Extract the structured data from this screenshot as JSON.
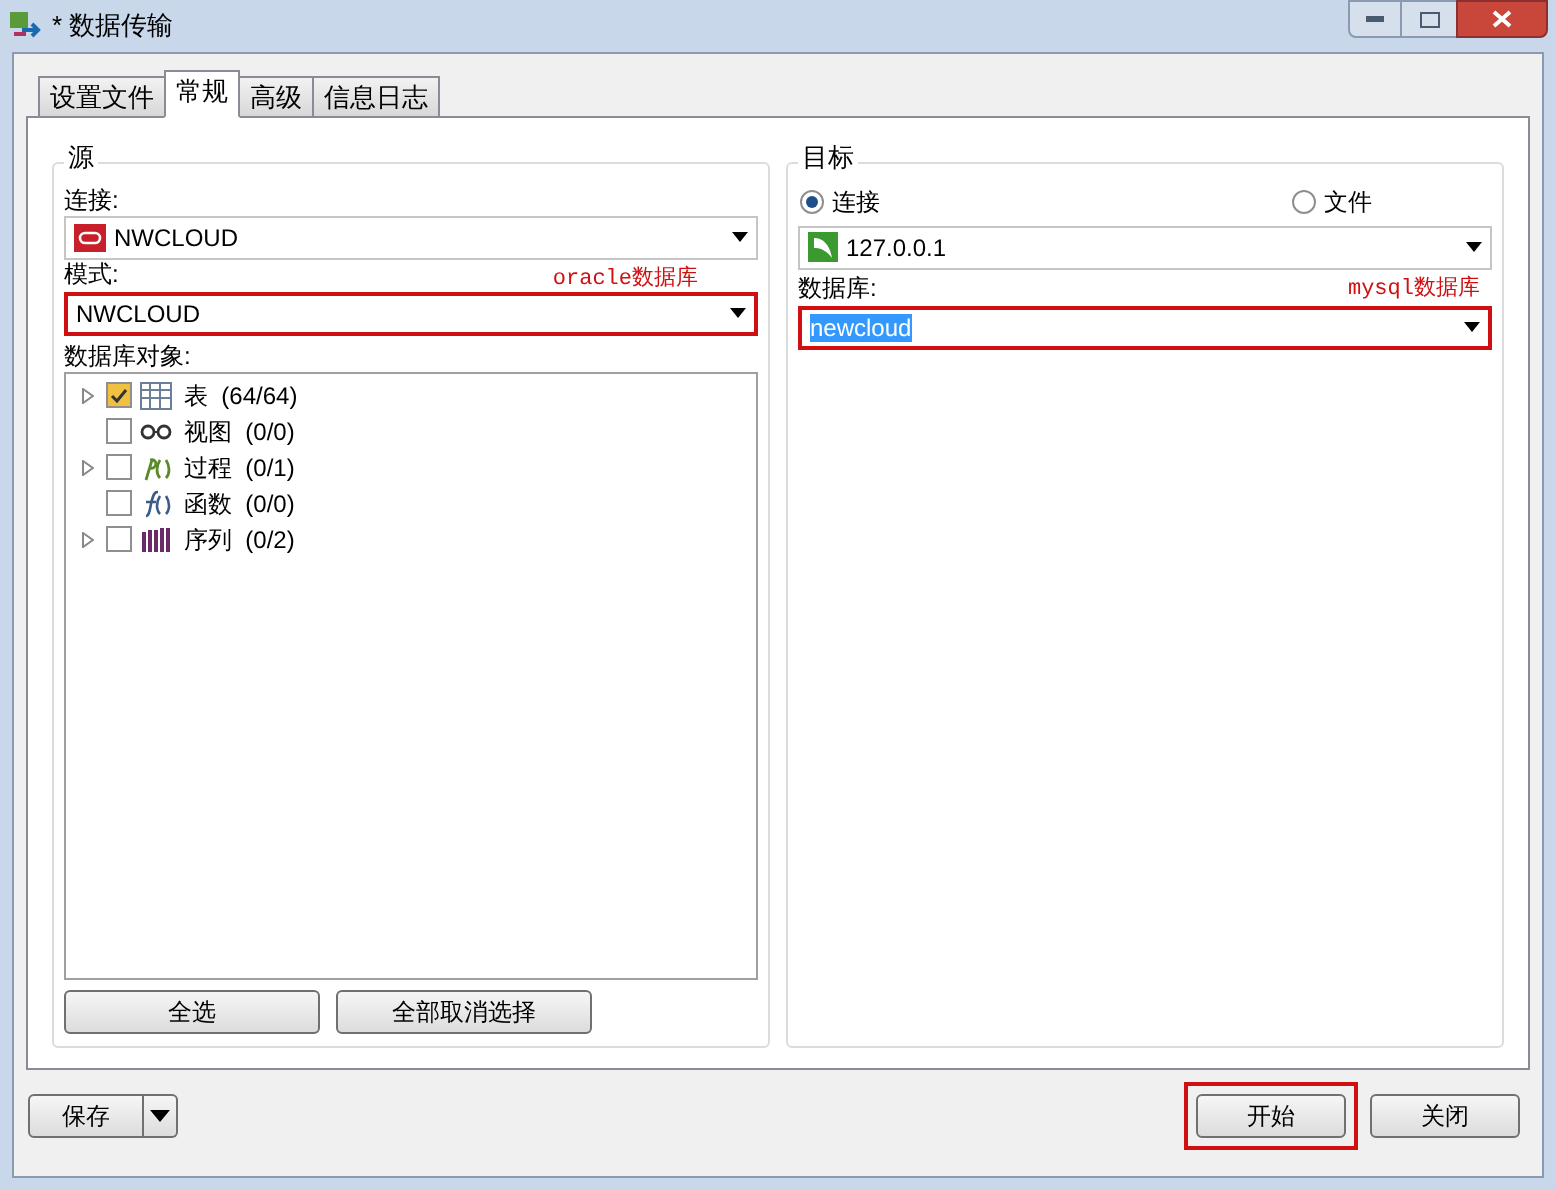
{
  "window": {
    "title": "* 数据传输"
  },
  "tabs": [
    {
      "label": "设置文件",
      "selected": false
    },
    {
      "label": "常规",
      "selected": true
    },
    {
      "label": "高级",
      "selected": false
    },
    {
      "label": "信息日志",
      "selected": false
    }
  ],
  "source": {
    "title": "源",
    "connection_label": "连接:",
    "connection": "NWCLOUD",
    "schema_label": "模式:",
    "schema": "NWCLOUD",
    "schema_annotation": "oracle数据库",
    "objects_label": "数据库对象:",
    "objects": [
      {
        "kind": "table",
        "label": "表",
        "count": "(64/64)",
        "checked": true,
        "has_children": true
      },
      {
        "kind": "view",
        "label": "视图",
        "count": "(0/0)",
        "checked": false,
        "has_children": false
      },
      {
        "kind": "procedure",
        "label": "过程",
        "count": "(0/1)",
        "checked": false,
        "has_children": true
      },
      {
        "kind": "function",
        "label": "函数",
        "count": "(0/0)",
        "checked": false,
        "has_children": false
      },
      {
        "kind": "sequence",
        "label": "序列",
        "count": "(0/2)",
        "checked": false,
        "has_children": true
      }
    ],
    "buttons": [
      "全选",
      "全部取消选择"
    ]
  },
  "target": {
    "title": "目标",
    "modes": [
      {
        "label": "连接",
        "selected": true
      },
      {
        "label": "文件",
        "selected": false
      }
    ],
    "connection": "127.0.0.1",
    "database_label": "数据库:",
    "database": "newcloud",
    "database_annotation": "mysql数据库"
  },
  "footer": {
    "save": "保存",
    "buttons": [
      "开始",
      "关闭"
    ]
  }
}
